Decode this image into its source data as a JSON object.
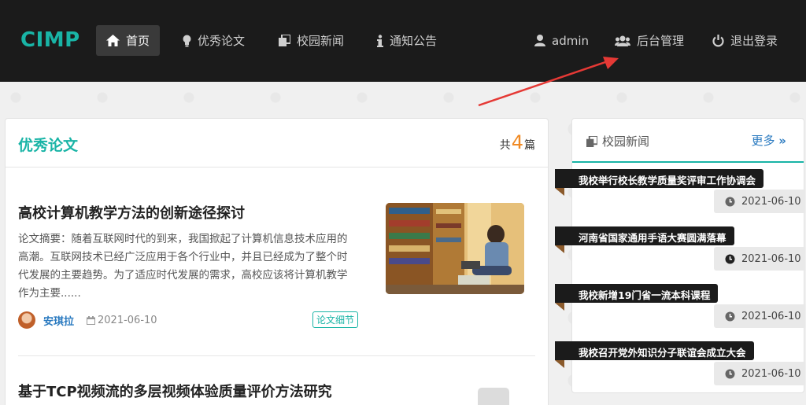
{
  "brand": "CIMP",
  "nav": {
    "home": "首页",
    "papers": "优秀论文",
    "news": "校园新闻",
    "notice": "通知公告",
    "user": "admin",
    "admin": "后台管理",
    "logout": "退出登录"
  },
  "main": {
    "title": "优秀论文",
    "count_prefix": "共",
    "count": "4",
    "count_suffix": "篇",
    "articles": [
      {
        "title": "高校计算机教学方法的创新途径探讨",
        "abstract": "论文摘要：随着互联网时代的到来，我国掀起了计算机信息技术应用的高潮。互联网技术已经广泛应用于各个行业中，并且已经成为了整个时代发展的主要趋势。为了适应时代发展的需求，高校应该将计算机教学作为主要......",
        "author": "安琪拉",
        "date": "2021-06-10",
        "tag": "论文细节"
      },
      {
        "title": "基于TCP视频流的多层视频体验质量评价方法研究"
      }
    ]
  },
  "side": {
    "title": "校园新闻",
    "more": "更多",
    "items": [
      {
        "title": "我校举行校长教学质量奖评审工作协调会",
        "date": "2021-06-10"
      },
      {
        "title": "河南省国家通用手语大赛圆满落幕",
        "date": "2021-06-10"
      },
      {
        "title": "我校新增19门省一流本科课程",
        "date": "2021-06-10"
      },
      {
        "title": "我校召开党外知识分子联谊会成立大会",
        "date": "2021-06-10"
      }
    ]
  },
  "colors": {
    "accent": "#19b4a6",
    "navbar": "#1b1b1b",
    "count": "#f08a24",
    "link": "#2a7ac0",
    "annotation": "#e53935"
  }
}
